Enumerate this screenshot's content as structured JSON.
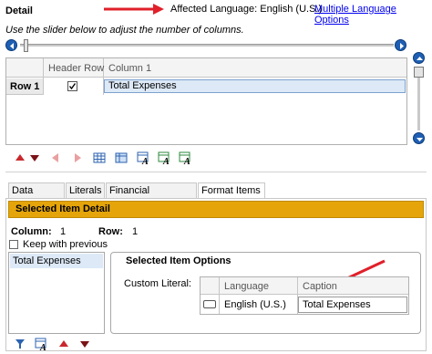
{
  "header": {
    "title": "Detail",
    "affected_language_label": "Affected Language: English (U.S.)",
    "multi_language_link": "Multiple Language Options"
  },
  "slider": {
    "instruction": "Use the slider below to adjust the number of columns."
  },
  "grid": {
    "columns": [
      "Header Row",
      "Column 1"
    ],
    "rows": [
      {
        "label": "Row 1",
        "header_checked": true,
        "value": "Total Expenses"
      }
    ]
  },
  "tabs": [
    "Data Points",
    "Literals",
    "Financial Workbook",
    "Format Items"
  ],
  "active_tab": "Format Items",
  "selected_item": {
    "banner": "Selected Item Detail",
    "column_label": "Column:",
    "column_value": "1",
    "row_label": "Row:",
    "row_value": "1",
    "keep_with_previous": "Keep with previous",
    "list_items": [
      "Total Expenses"
    ]
  },
  "options": {
    "title": "Selected Item Options",
    "custom_literal_label": "Custom Literal:",
    "columns": [
      "Language",
      "Caption"
    ],
    "rows": [
      {
        "language": "English (U.S.)",
        "caption": "Total Expenses"
      }
    ]
  },
  "colors": {
    "banner": "#e5a50a",
    "selected_row": "#dde9f7",
    "accent": "#1f5fb3",
    "arrow": "#e0202a"
  },
  "icons": [
    "arrow-up-icon",
    "arrow-down-icon",
    "arrow-left-icon",
    "arrow-right-icon",
    "insert-table-icon",
    "format-table-icon",
    "edit-cell-icon",
    "filter-icon"
  ]
}
